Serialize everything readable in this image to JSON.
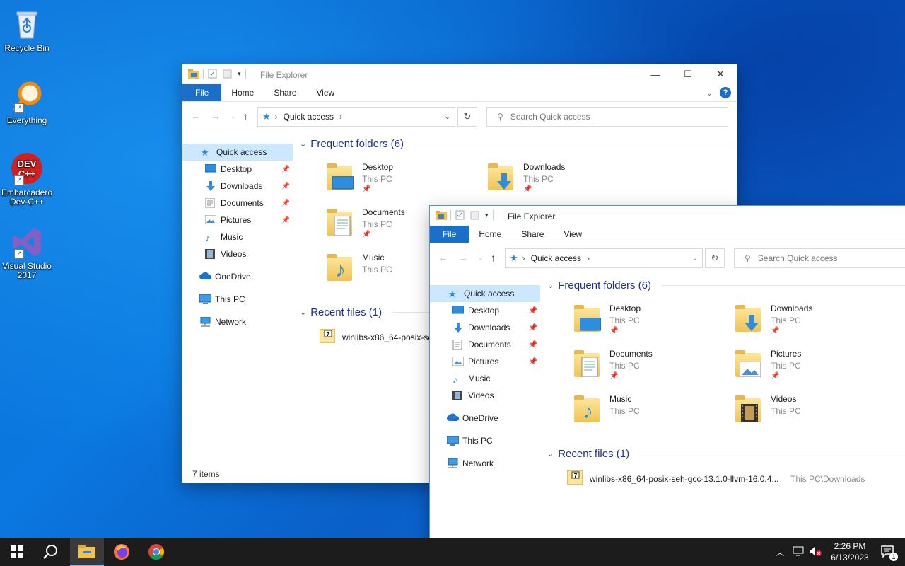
{
  "desktop": {
    "icons": [
      {
        "label": "Recycle Bin"
      },
      {
        "label": "Everything"
      },
      {
        "label": "Embarcadero Dev-C++"
      },
      {
        "label": "Visual Studio 2017"
      }
    ]
  },
  "back_window": {
    "title": "File Explorer",
    "tabs": [
      "File",
      "Home",
      "Share",
      "View"
    ],
    "address": "Quick access",
    "search_placeholder": "Search Quick access",
    "nav": {
      "quick_access": "Quick access",
      "items": [
        "Desktop",
        "Downloads",
        "Documents",
        "Pictures",
        "Music",
        "Videos"
      ],
      "onedrive": "OneDrive",
      "thispc": "This PC",
      "network": "Network"
    },
    "frequent_header": "Frequent folders (6)",
    "folders": [
      {
        "name": "Desktop",
        "location": "This PC"
      },
      {
        "name": "Downloads",
        "location": "This PC"
      },
      {
        "name": "Documents",
        "location": "This PC"
      },
      {
        "name": "Music",
        "location": "This PC"
      }
    ],
    "recent_header": "Recent files (1)",
    "recent_file": "winlibs-x86_64-posix-se",
    "status": "7 items"
  },
  "front_window": {
    "title": "File Explorer",
    "tabs": [
      "File",
      "Home",
      "Share",
      "View"
    ],
    "address": "Quick access",
    "search_placeholder": "Search Quick access",
    "nav": {
      "quick_access": "Quick access",
      "items": [
        "Desktop",
        "Downloads",
        "Documents",
        "Pictures",
        "Music",
        "Videos"
      ],
      "onedrive": "OneDrive",
      "thispc": "This PC",
      "network": "Network"
    },
    "frequent_header": "Frequent folders (6)",
    "folders": [
      {
        "name": "Desktop",
        "location": "This PC"
      },
      {
        "name": "Downloads",
        "location": "This PC"
      },
      {
        "name": "Documents",
        "location": "This PC"
      },
      {
        "name": "Pictures",
        "location": "This PC"
      },
      {
        "name": "Music",
        "location": "This PC"
      },
      {
        "name": "Videos",
        "location": "This PC"
      }
    ],
    "recent_header": "Recent files (1)",
    "recent_file": "winlibs-x86_64-posix-seh-gcc-13.1.0-llvm-16.0.4...",
    "recent_path": "This PC\\Downloads"
  },
  "taskbar": {
    "time": "2:26 PM",
    "date": "6/13/2023",
    "notification_count": "1"
  },
  "colors": {
    "accent": "#1a6fc8",
    "selection": "#cce8ff",
    "group_header": "#1e3287",
    "taskbar": "#1c1c1c"
  }
}
